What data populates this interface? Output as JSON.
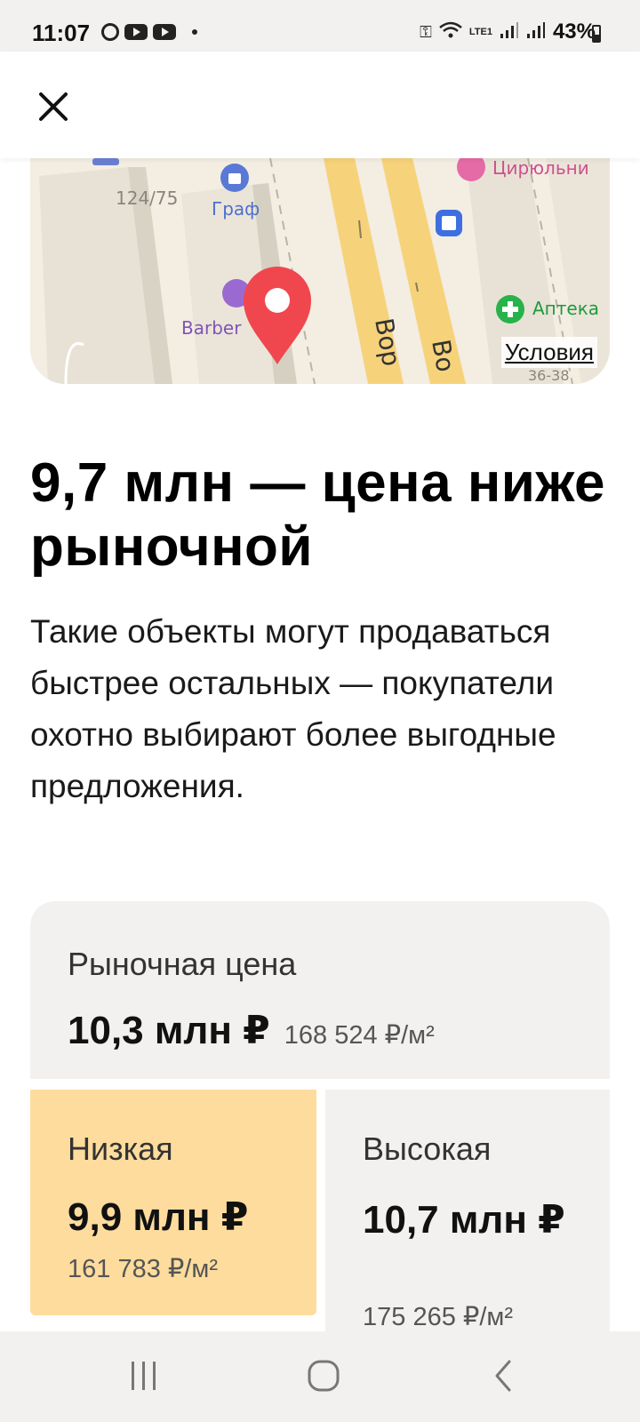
{
  "status_bar": {
    "time": "11:07",
    "battery": "43%",
    "network_label": "LTE1"
  },
  "map": {
    "labels": {
      "building_number": "124/75",
      "shop": "Граф",
      "barber": "Barber",
      "salon": "Цирюльни",
      "pharmacy": "Аптека",
      "street_1": "Вор",
      "street_2": "Во",
      "house_number": "36-38"
    },
    "terms_link": "Условия"
  },
  "content": {
    "title": "9,7 млн — цена ниже рыночной",
    "description": "Такие объекты могут продаваться быстрее остальных — покупатели охотно выбирают более выгодные предложения."
  },
  "prices": {
    "market": {
      "label": "Рыночная цена",
      "value": "10,3 млн ₽",
      "per_meter": "168 524 ₽/м²"
    },
    "low": {
      "label": "Низкая",
      "value": "9,9 млн ₽",
      "per_meter": "161 783 ₽/м²"
    },
    "high": {
      "label": "Высокая",
      "value": "10,7 млн ₽",
      "per_meter": "175 265 ₽/м²"
    }
  },
  "colors": {
    "accent_pin": "#f0474f",
    "low_card_bg": "#fedc9d",
    "card_bg": "#f2f1ef",
    "road_yellow": "#f6d27a"
  }
}
